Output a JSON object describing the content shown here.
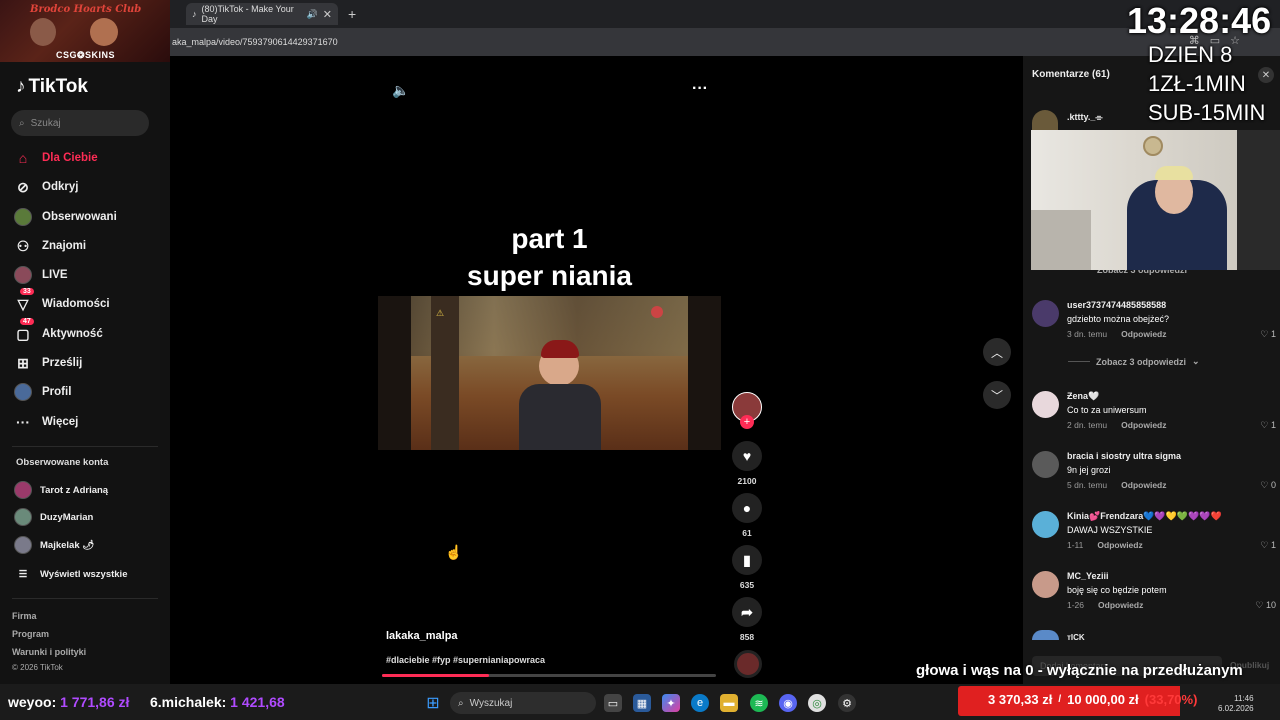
{
  "browser": {
    "tab_title": "(80)TikTok - Make Your Day",
    "url": "aka_malpa/video/7593790614429371670"
  },
  "stream": {
    "banner_title": "Brodco Hoarts Club",
    "sponsor": "CSG❂SKINS",
    "clock": "13:28:46",
    "day": "DZIEN 8",
    "rate1": "1ZŁ-1MIN",
    "rate2": "SUB-15MIN",
    "subtitle": "głowa i wąs na 0 - wyłącznie na przedłużanym",
    "donors": [
      {
        "name": "weyoo:",
        "amount": "1 771,86 zł"
      },
      {
        "name": "6.michalek:",
        "amount": "1 421,68"
      }
    ],
    "goal_current": "3 370,33 zł",
    "goal_target": "10 000,00 zł",
    "goal_percent": "(33,70%)",
    "goal_progress": 0.337
  },
  "sidebar": {
    "logo": "TikTok",
    "search_placeholder": "Szukaj",
    "nav": [
      {
        "label": "Dla Ciebie",
        "icon": "home-icon"
      },
      {
        "label": "Odkryj",
        "icon": "compass-icon"
      },
      {
        "label": "Obserwowani",
        "icon": "following-avatar"
      },
      {
        "label": "Znajomi",
        "icon": "friends-icon"
      },
      {
        "label": "LIVE",
        "icon": "live-avatar"
      },
      {
        "label": "Wiadomości",
        "icon": "message-icon",
        "badge": "33"
      },
      {
        "label": "Aktywność",
        "icon": "activity-icon",
        "badge": "47"
      },
      {
        "label": "Prześlij",
        "icon": "upload-icon"
      },
      {
        "label": "Profil",
        "icon": "profile-avatar"
      },
      {
        "label": "Więcej",
        "icon": "more-icon"
      }
    ],
    "following_title": "Obserwowane konta",
    "following": [
      {
        "name": "Tarot z Adrianą"
      },
      {
        "name": "DuzyMarian"
      },
      {
        "name": "Majkelak 🌶"
      }
    ],
    "see_all": "Wyświetl wszystkie",
    "footer": [
      "Firma",
      "Program",
      "Warunki i polityki",
      "© 2026 TikTok"
    ]
  },
  "video": {
    "title_line1": "part 1",
    "title_line2": "super niania",
    "author": "lakaka_malpa",
    "tags": "#dlaciebie #fyp #supernianiapowraca",
    "likes": "2100",
    "comments": "61",
    "saves": "635",
    "shares": "858",
    "progress": 0.32
  },
  "comments": {
    "header": "Komentarze (61)",
    "first_user": ".kttty._⌯",
    "see_replies_hidden": "Zobacz 3 odpowiedzi",
    "items": [
      {
        "user": "user3737474485858588",
        "text": "gdziebto można obejżeć?",
        "time": "3 dn. temu",
        "reply": "Odpowiedz",
        "likes": "1",
        "replies": "Zobacz 3 odpowiedzi"
      },
      {
        "user": "Ƶena🤍",
        "text": "Co to za uniwersum",
        "time": "2 dn. temu",
        "reply": "Odpowiedz",
        "likes": "1"
      },
      {
        "user": "bracia i siostry ultra sigma",
        "text": "9n jej grozi",
        "time": "5 dn. temu",
        "reply": "Odpowiedz",
        "likes": "0"
      },
      {
        "user": "Kinia💕Frendzara💙💜💛💚💜💜❤️",
        "text": "DAWAJ WSZYSTKIE",
        "time": "1-11",
        "reply": "Odpowiedz",
        "likes": "1"
      },
      {
        "user": "MC_Yeziii",
        "text": "boję się co będzie potem",
        "time": "1-26",
        "reply": "Odpowiedz",
        "likes": "10"
      },
      {
        "user": "тICK"
      }
    ],
    "input_placeholder": "Dodaj komentarz...",
    "post_label": "Opublikuj"
  },
  "taskbar": {
    "search_placeholder": "Wyszukaj",
    "time": "11:46",
    "date": "6.02.2026"
  },
  "colors": {
    "accent": "#fe2c55",
    "donor_amount": "#b04bff"
  }
}
